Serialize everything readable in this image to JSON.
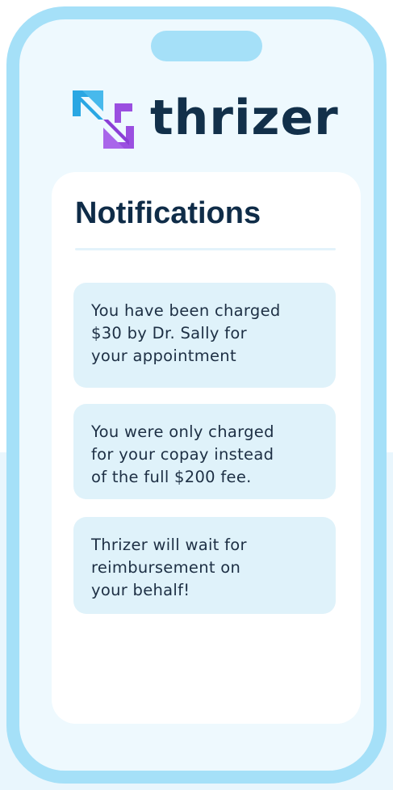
{
  "brand": {
    "name": "thrizer",
    "logo_icon": "thrizer-logo-icon",
    "colors": {
      "primary_text": "#12304a",
      "logo_blue": "#2aa7e3",
      "logo_purple": "#9a4fe0",
      "phone_frame": "#a5e0f8",
      "notification_bg": "#dff2fa"
    }
  },
  "screen": {
    "title": "Notifications",
    "notifications": [
      {
        "lines": [
          "You have been charged",
          "$30 by Dr. Sally for",
          "your appointment"
        ]
      },
      {
        "lines": [
          "You were only charged",
          "for your copay instead",
          "of the full $200 fee."
        ]
      },
      {
        "lines": [
          "Thrizer will wait for",
          "reimbursement on",
          "your behalf!"
        ]
      }
    ]
  }
}
